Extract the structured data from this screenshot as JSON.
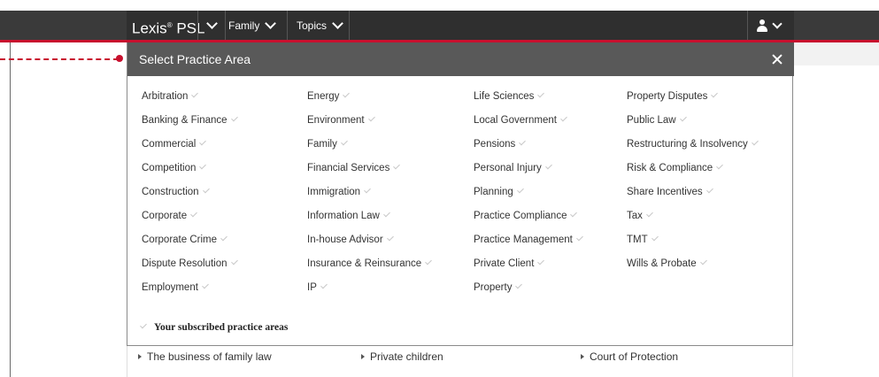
{
  "nav": {
    "brand_main": "Lexis",
    "brand_reg": "®",
    "brand_suffix": "PSL",
    "family_label": "Family",
    "topics_label": "Topics"
  },
  "panel": {
    "title": "Select Practice Area",
    "columns": [
      [
        "Arbitration",
        "Banking & Finance",
        "Commercial",
        "Competition",
        "Construction",
        "Corporate",
        "Corporate Crime",
        "Dispute Resolution",
        "Employment"
      ],
      [
        "Energy",
        "Environment",
        "Family",
        "Financial Services",
        "Immigration",
        "Information Law",
        "In-house Advisor",
        "Insurance & Reinsurance",
        "IP"
      ],
      [
        "Life Sciences",
        "Local Government",
        "Pensions",
        "Personal Injury",
        "Planning",
        "Practice Compliance",
        "Practice Management",
        "Private Client",
        "Property"
      ],
      [
        "Property Disputes",
        "Public Law",
        "Restructuring & Insolvency",
        "Risk & Compliance",
        "Share Incentives",
        "Tax",
        "TMT",
        "Wills & Probate"
      ]
    ],
    "subscribed_label": "Your subscribed practice areas"
  },
  "below": {
    "links": [
      "The business of family law",
      "Private children",
      "Court of Protection"
    ]
  },
  "colors": {
    "accent_red": "#c8102e",
    "nav_bg": "#2f2f2f",
    "header_bg": "#595959"
  }
}
